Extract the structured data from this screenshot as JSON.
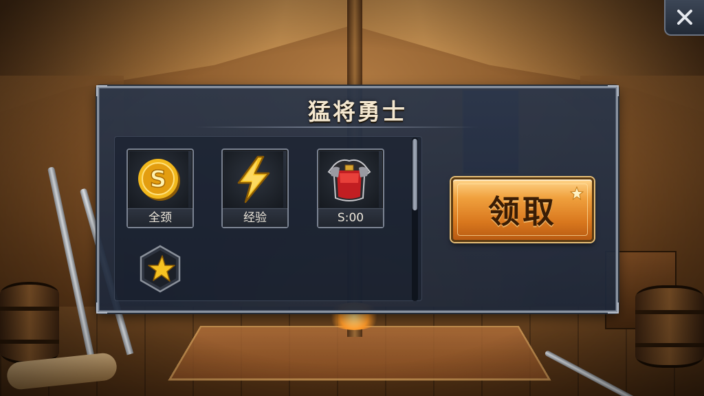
{
  "dialog": {
    "title": "猛将勇士",
    "rewards": [
      {
        "label": "全颈",
        "icon": "gold-coin-icon"
      },
      {
        "label": "经验",
        "icon": "lightning-bolt-icon"
      },
      {
        "label": "S:00",
        "icon": "red-armor-icon"
      }
    ],
    "extra_badge_icon": "star-icon",
    "claim_button_label": "领取"
  },
  "controls": {
    "close_icon": "close-icon"
  },
  "colors": {
    "panel_bg": "#1e2a3c",
    "border": "#8a93a0",
    "title_text": "#f4e7cf",
    "button_orange": "#e08a2a",
    "button_text": "#3a1d05",
    "gold": "#f2b81c"
  }
}
